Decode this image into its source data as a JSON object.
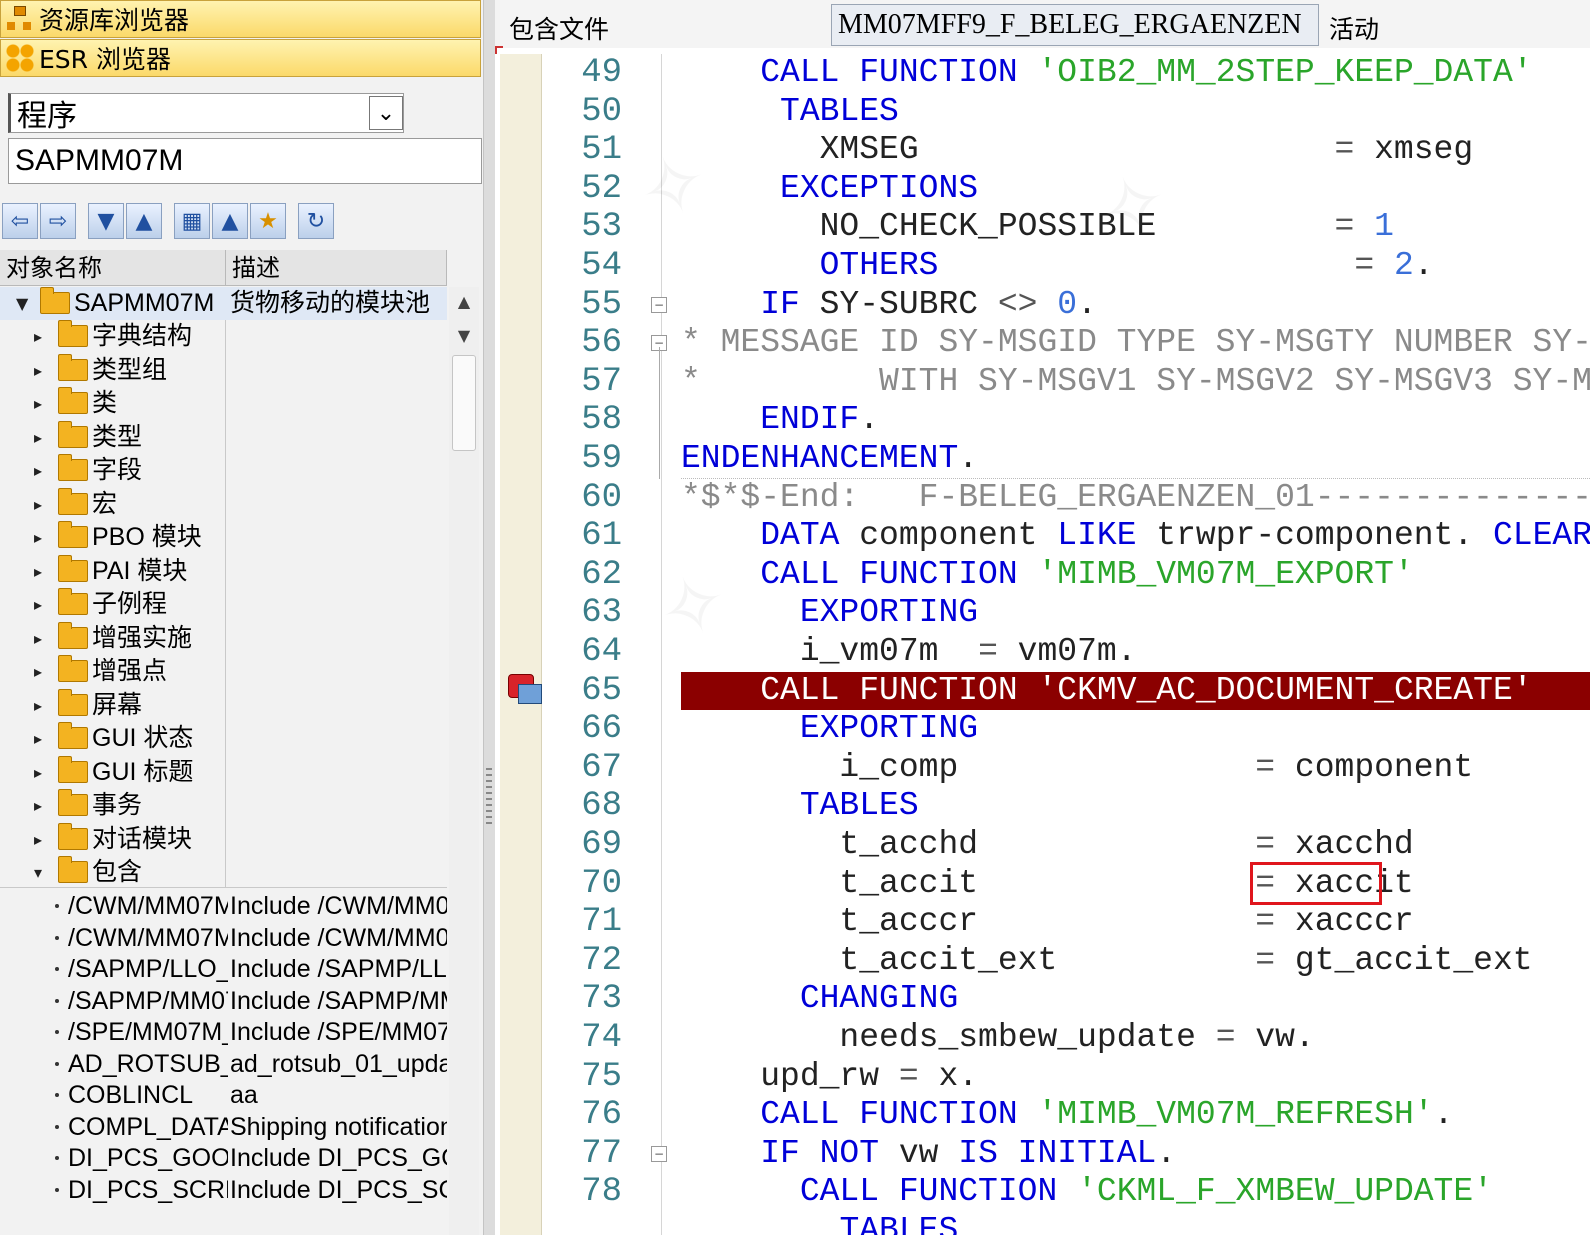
{
  "nav": {
    "repository_browser": "资源库浏览器",
    "esr_browser": "ESR 浏览器"
  },
  "selector": {
    "object_type": "程序",
    "object_name": "SAPMM07M"
  },
  "toolbar": {
    "icons": [
      "back-icon",
      "forward-icon",
      "expand-icon",
      "collapse-icon",
      "where-used-icon",
      "hierarchy-icon",
      "favorites-icon",
      "refresh-icon"
    ]
  },
  "tree": {
    "columns": {
      "name": "对象名称",
      "desc": "描述"
    },
    "root": {
      "name": "SAPMM07M",
      "desc": "货物移动的模块池"
    },
    "folders": [
      "字典结构",
      "类型组",
      "类",
      "类型",
      "字段",
      "宏",
      "PBO 模块",
      "PAI 模块",
      "子例程",
      "增强实施",
      "增强点",
      "屏幕",
      "GUI 状态",
      "GUI 标题",
      "事务",
      "对话模块",
      "包含"
    ],
    "includes": [
      {
        "name": "/CWM/MM07M",
        "desc": "Include /CWM/MM0"
      },
      {
        "name": "/CWM/MM07M",
        "desc": "Include /CWM/MM0"
      },
      {
        "name": "/SAPMP/LLO_",
        "desc": "Include /SAPMP/LL"
      },
      {
        "name": "/SAPMP/MM07",
        "desc": "Include /SAPMP/MM"
      },
      {
        "name": "/SPE/MM07M_",
        "desc": "Include /SPE/MM07"
      },
      {
        "name": "AD_ROTSUB_",
        "desc": "ad_rotsub_01_upda"
      },
      {
        "name": "COBLINCL",
        "desc": "aa"
      },
      {
        "name": "COMPL_DATA",
        "desc": "Shipping notification"
      },
      {
        "name": "DI_PCS_GOOI",
        "desc": "Include DI_PCS_GO"
      },
      {
        "name": "DI_PCS_SCRE",
        "desc": "Include DI_PCS_SC"
      }
    ]
  },
  "editor": {
    "include_label": "包含文件",
    "include_name": "MM07MFF9_F_BELEG_ERGAENZEN",
    "status": "活动",
    "line_numbers": [
      "49",
      "50",
      "51",
      "52",
      "53",
      "54",
      "55",
      "56",
      "57",
      "58",
      "59",
      "60",
      "61",
      "62",
      "63",
      "64",
      "65",
      "66",
      "67",
      "68",
      "69",
      "70",
      "71",
      "72",
      "73",
      "74",
      "75",
      "76",
      "77",
      "78"
    ],
    "highlighted_line": "65",
    "boxed_token": "xaccit"
  }
}
